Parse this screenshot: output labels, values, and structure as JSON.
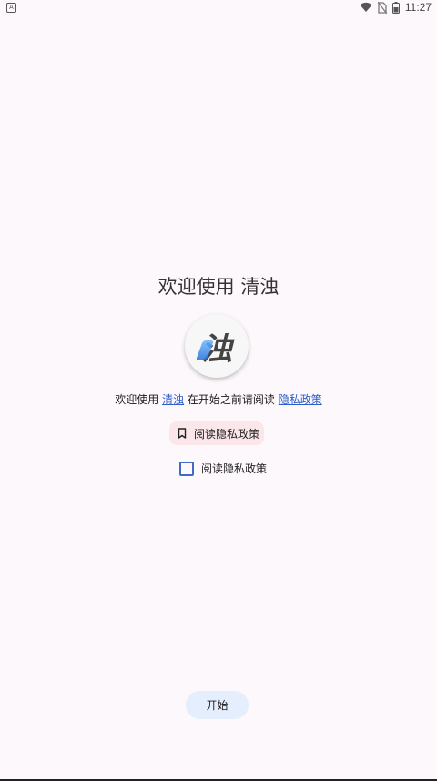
{
  "status_bar": {
    "time": "11:27",
    "notification_icon_letter": "A"
  },
  "welcome": {
    "title": "欢迎使用 清浊",
    "logo_char": "浊",
    "line_prefix": "欢迎使用 ",
    "app_name_link": "清浊",
    "line_middle": " 在开始之前请阅读 ",
    "privacy_link": "隐私政策 "
  },
  "chip": {
    "label": "阅读隐私政策"
  },
  "checkbox": {
    "label": "阅读隐私政策",
    "checked": false
  },
  "footer": {
    "start_label": "开始"
  },
  "colors": {
    "accent": "#2b5ec9",
    "chip_bg": "#fbe7ea",
    "button_bg": "#e4eefc",
    "background": "#fdf8fc"
  }
}
